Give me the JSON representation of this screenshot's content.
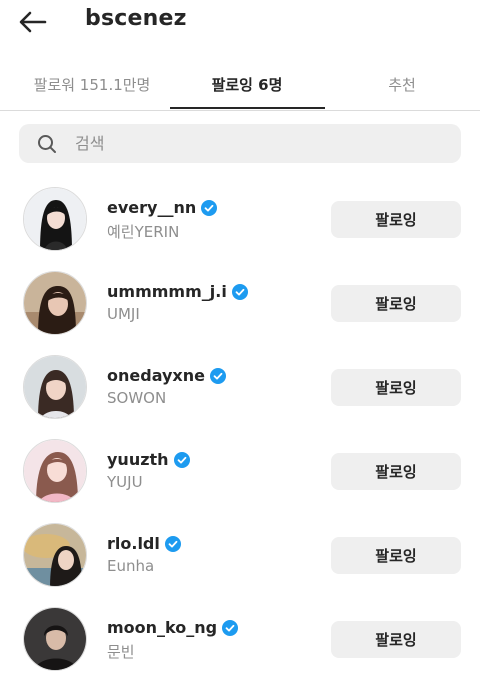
{
  "header": {
    "title": "bscenez",
    "back_icon": "arrow-left-icon"
  },
  "tabs": [
    {
      "label": "팔로워 151.1만명",
      "active": false
    },
    {
      "label": "팔로잉 6명",
      "active": true
    },
    {
      "label": "추천",
      "active": false
    }
  ],
  "search": {
    "placeholder": "검색",
    "icon": "search-icon"
  },
  "accounts": [
    {
      "username": "every__nn",
      "full_name": "예린YERIN",
      "verified": true,
      "button": "팔로잉"
    },
    {
      "username": "ummmmm_j.i",
      "full_name": "UMJI",
      "verified": true,
      "button": "팔로잉"
    },
    {
      "username": "onedayxne",
      "full_name": "SOWON",
      "verified": true,
      "button": "팔로잉"
    },
    {
      "username": "yuuzth",
      "full_name": "YUJU",
      "verified": true,
      "button": "팔로잉"
    },
    {
      "username": "rlo.ldl",
      "full_name": "Eunha",
      "verified": true,
      "button": "팔로잉"
    },
    {
      "username": "moon_ko_ng",
      "full_name": "문빈",
      "verified": true,
      "button": "팔로잉"
    }
  ],
  "colors": {
    "verified_badge": "#1d9bf0",
    "button_bg": "#efefef",
    "secondary_text": "#8e8e8e"
  }
}
